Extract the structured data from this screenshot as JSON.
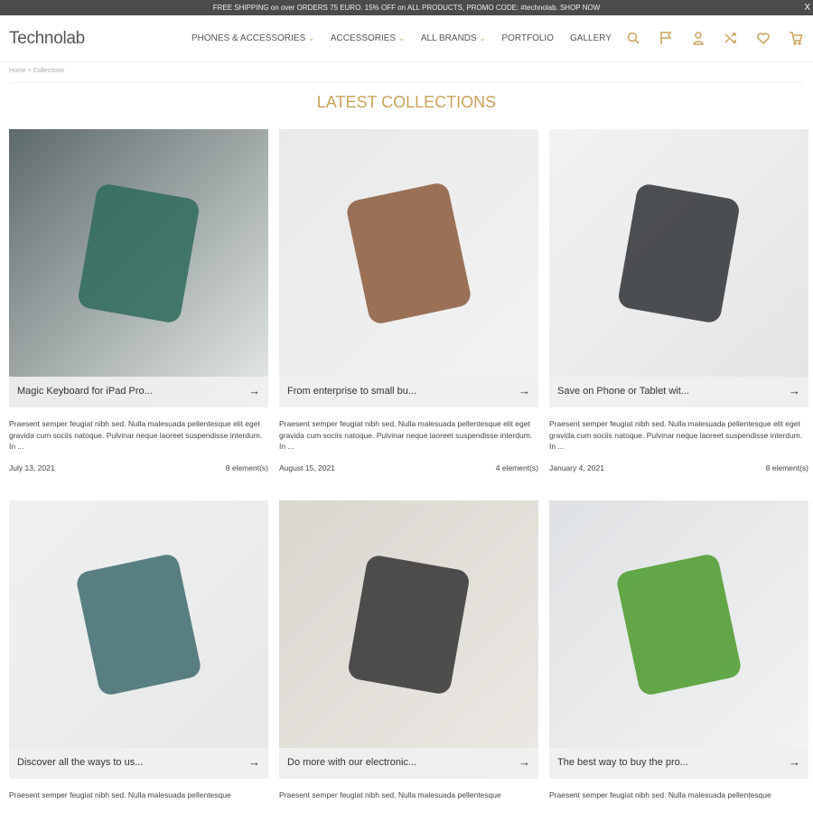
{
  "topbar": {
    "text": "FREE SHIPPING on over ORDERS 75 EURO. 15% OFF on ALL PRODUCTS, PROMO CODE: #technolab. SHOP NOW",
    "close": "X"
  },
  "header": {
    "logo": "Technolab",
    "nav": [
      "PHONES & ACCESSORIES",
      "ACCESSORIES",
      "ALL BRANDS",
      "PORTFOLIO",
      "GALLERY"
    ],
    "icons": [
      "search-icon",
      "flag-icon",
      "user-icon",
      "shuffle-icon",
      "heart-icon",
      "cart-icon"
    ],
    "accent": "#c9a45c"
  },
  "breadcrumb": {
    "home": "Home",
    "sep": ">",
    "current": "Collections"
  },
  "page_title": "LATEST COLLECTIONS",
  "collections": [
    {
      "title": "Magic Keyboard for iPad Pro...",
      "desc": "Praesent semper feugiat nibh sed. Nulla malesuada pellentesque elit eget gravida cum sociis natoque. Pulvinar neque laoreet suspendisse interdum. In ...",
      "date": "July 13, 2021",
      "count": "8 element(s)",
      "colors": [
        "#5d6a6a",
        "#e8ecea",
        "#2e6b5a"
      ]
    },
    {
      "title": "From enterprise to small bu...",
      "desc": "Praesent semper feugiat nibh sed. Nulla malesuada pellentesque elit eget gravida cum sociis natoque. Pulvinar neque laoreet suspendisse interdum. In ...",
      "date": "August 15, 2021",
      "count": "4 element(s)",
      "colors": [
        "#e9e9e9",
        "#f3f3f3",
        "#8b5a3c"
      ]
    },
    {
      "title": "Save on Phone or Tablet wit...",
      "desc": "Praesent semper feugiat nibh sed. Nulla malesuada pellentesque elit eget gravida cum sociis natoque. Pulvinar neque laoreet suspendisse interdum. In ...",
      "date": "January 4, 2021",
      "count": "8 element(s)",
      "colors": [
        "#f2f2f2",
        "#e4e4e4",
        "#2f3336"
      ]
    },
    {
      "title": "Discover all the ways to us...",
      "desc": "Praesent semper feugiat nibh sed. Nulla malesuada pellentesque",
      "colors": [
        "#f0f0f0",
        "#e6e8e8",
        "#3e6b6e"
      ]
    },
    {
      "title": "Do more with our electronic...",
      "desc": "Praesent semper feugiat nibh sed. Nulla malesuada pellentesque",
      "colors": [
        "#d9d6d0",
        "#ece9e4",
        "#333"
      ]
    },
    {
      "title": "The best way to buy the pro...",
      "desc": "Praesent semper feugiat nibh sed. Nulla malesuada pellentesque",
      "colors": [
        "#dfe2e4",
        "#f3f3f3",
        "#4a9a2a"
      ]
    }
  ]
}
